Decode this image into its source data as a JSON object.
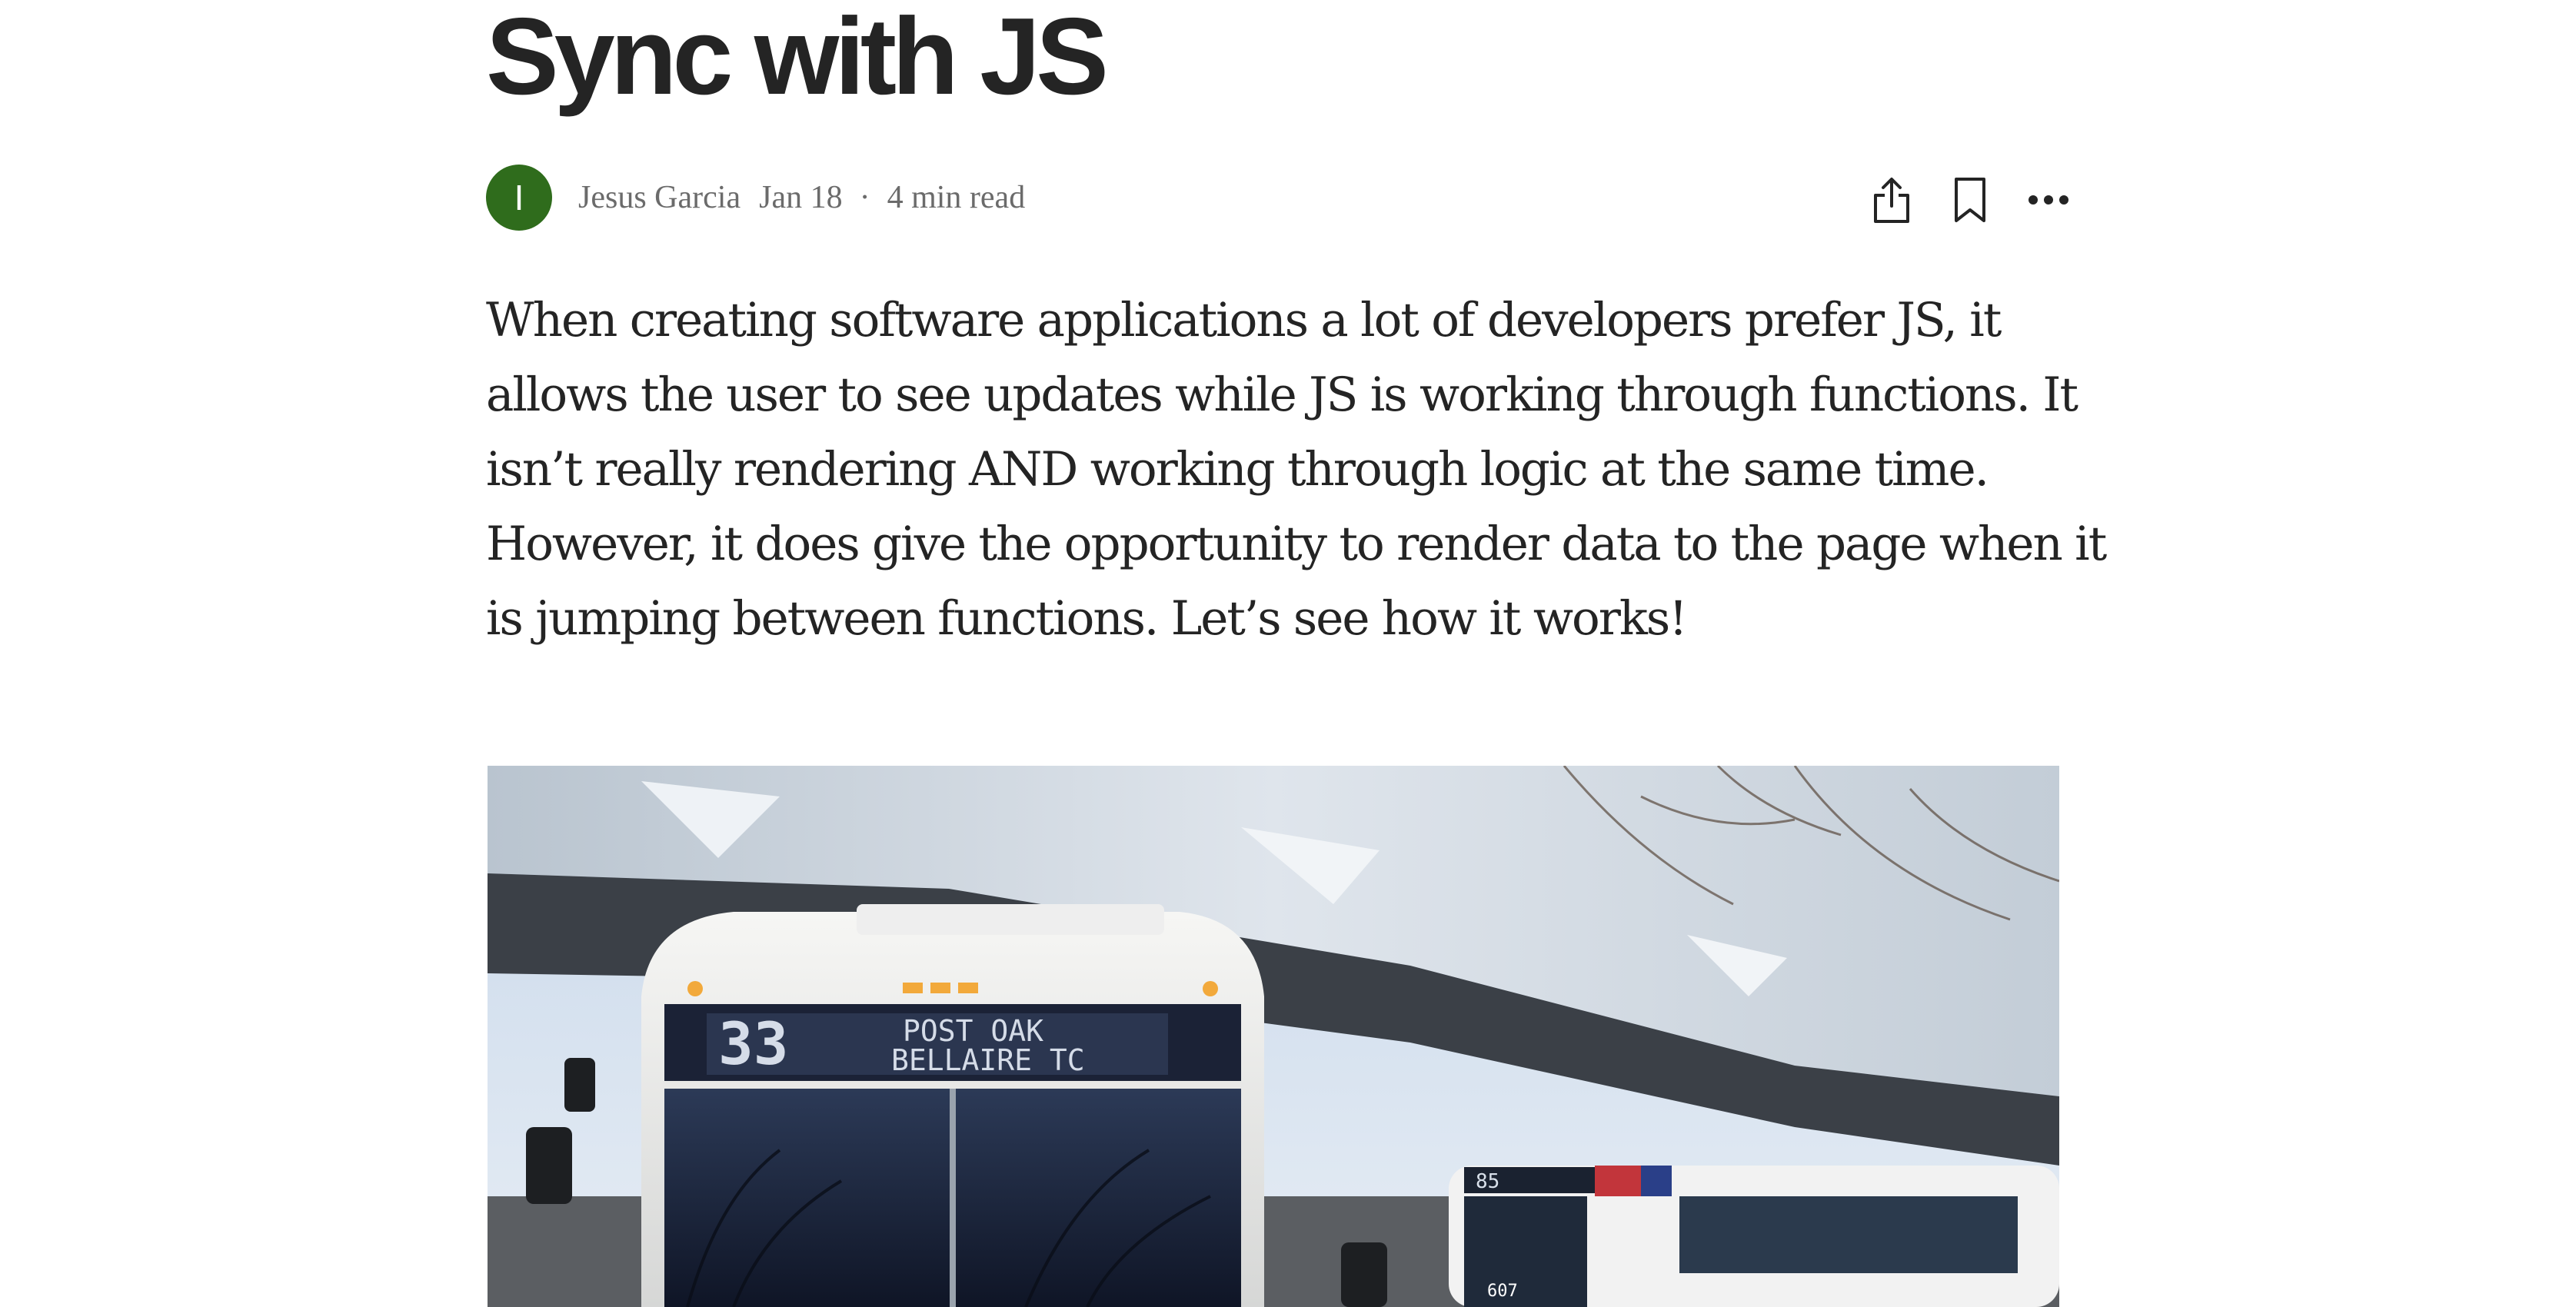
{
  "article": {
    "title": "Sync with JS",
    "author": {
      "initial": "I",
      "name": "Jesus Garcia",
      "avatar_color": "#2f6c1c"
    },
    "date": "Jan 18",
    "separator": "·",
    "read_time": "4 min read",
    "actions": [
      {
        "name": "share",
        "icon": "share-icon"
      },
      {
        "name": "save",
        "icon": "bookmark-icon"
      },
      {
        "name": "more",
        "icon": "more-icon"
      }
    ],
    "intro": "When creating software applications a lot of developers prefer JS, it allows the user to see updates while JS is working through functions. It isn’t really rendering AND working through logic at the same time. However, it does give the opportunity to render data to the page when it is jumping between functions. Let’s see how it works!"
  },
  "hero_image": {
    "description_icon": "bus-photo",
    "route_number": "33",
    "destination_line1": "POST OAK",
    "destination_line2": "BELLAIRE TC",
    "second_bus_number": "85",
    "second_bus_plate": "607"
  },
  "colors": {
    "text": "#242424",
    "muted": "#6b6b6b",
    "background": "#ffffff"
  }
}
